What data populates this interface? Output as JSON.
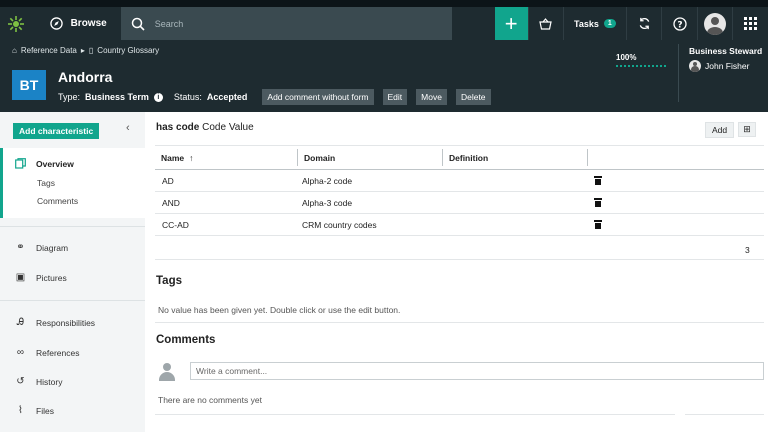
{
  "topbar": {
    "browse_label": "Browse",
    "search_placeholder": "Search",
    "tasks_label": "Tasks",
    "tasks_count": "1"
  },
  "header": {
    "breadcrumb": [
      "Reference Data",
      "Country Glossary"
    ],
    "asset_initials": "BT",
    "asset_name": "Andorra",
    "type_label": "Type:",
    "type_value": "Business Term",
    "status_label": "Status:",
    "status_value": "Accepted",
    "buttons": [
      "Add comment without form",
      "Edit",
      "Move",
      "Delete"
    ],
    "progress_label": "100%",
    "steward_role": "Business Steward",
    "steward_name": "John Fisher"
  },
  "sidebar": {
    "add_characteristic": "Add characteristic",
    "overview": "Overview",
    "overview_sub": [
      "Tags",
      "Comments"
    ],
    "items": [
      "Diagram",
      "Pictures",
      "Responsibilities",
      "References",
      "History",
      "Files"
    ]
  },
  "relation": {
    "title_bold": "has code",
    "title_rest": "Code Value",
    "add_label": "Add",
    "columns": [
      "Name",
      "Domain",
      "Definition"
    ],
    "sort_indicator": "↑",
    "rows": [
      {
        "name": "AD",
        "domain": "Alpha-2 code",
        "definition": ""
      },
      {
        "name": "AND",
        "domain": "Alpha-3 code",
        "definition": ""
      },
      {
        "name": "CC-AD",
        "domain": "CRM country codes",
        "definition": ""
      }
    ],
    "count": "3"
  },
  "tags": {
    "heading": "Tags",
    "empty_text": "No value has been given yet. Double click or use the edit button."
  },
  "comments": {
    "heading": "Comments",
    "placeholder": "Write a comment...",
    "empty_text": "There are no comments yet"
  }
}
